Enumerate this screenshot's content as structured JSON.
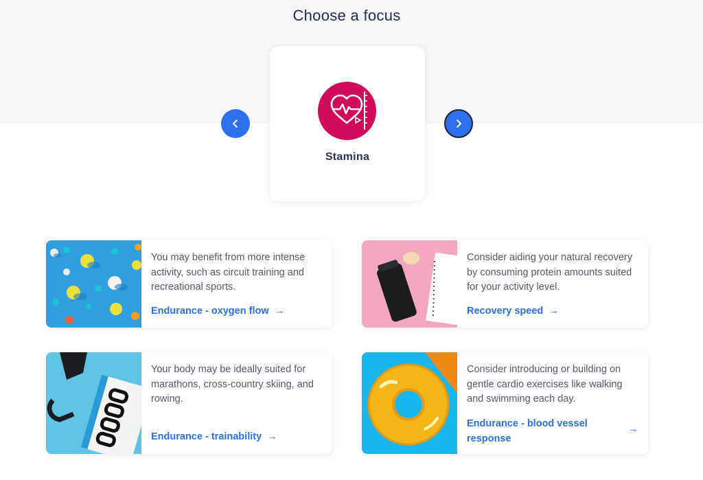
{
  "page": {
    "title": "Choose a focus"
  },
  "focus": {
    "label": "Stamina",
    "icon": "heart-rate-icon",
    "icon_bg": "#d10a5c",
    "prev_icon": "chevron-left-icon",
    "next_icon": "chevron-right-icon",
    "prev_glyph": "‹",
    "next_glyph": "›"
  },
  "tiles": [
    {
      "image": "colorful-balls-photo",
      "description": "You may benefit from more intense activity, such as circuit training and recreational sports.",
      "link": "Endurance - oxygen flow",
      "arrow": "→"
    },
    {
      "image": "protein-shaker-photo",
      "description": "Consider aiding your natural recovery by consuming protein amounts suited for your activity level.",
      "link": "Recovery speed",
      "arrow": "→"
    },
    {
      "image": "race-bib-photo",
      "description": "Your body may be ideally suited for marathons, cross-country skiing, and rowing.",
      "link": "Endurance - trainability",
      "arrow": "→"
    },
    {
      "image": "pool-float-photo",
      "description": "Consider introducing or building on gentle cardio exercises like walking and swimming each day.",
      "link": "Endurance - blood vessel response",
      "arrow": "→"
    }
  ],
  "colors": {
    "accent": "#2e6fec",
    "heading": "#232d5a",
    "band": "#f6f6f9"
  }
}
